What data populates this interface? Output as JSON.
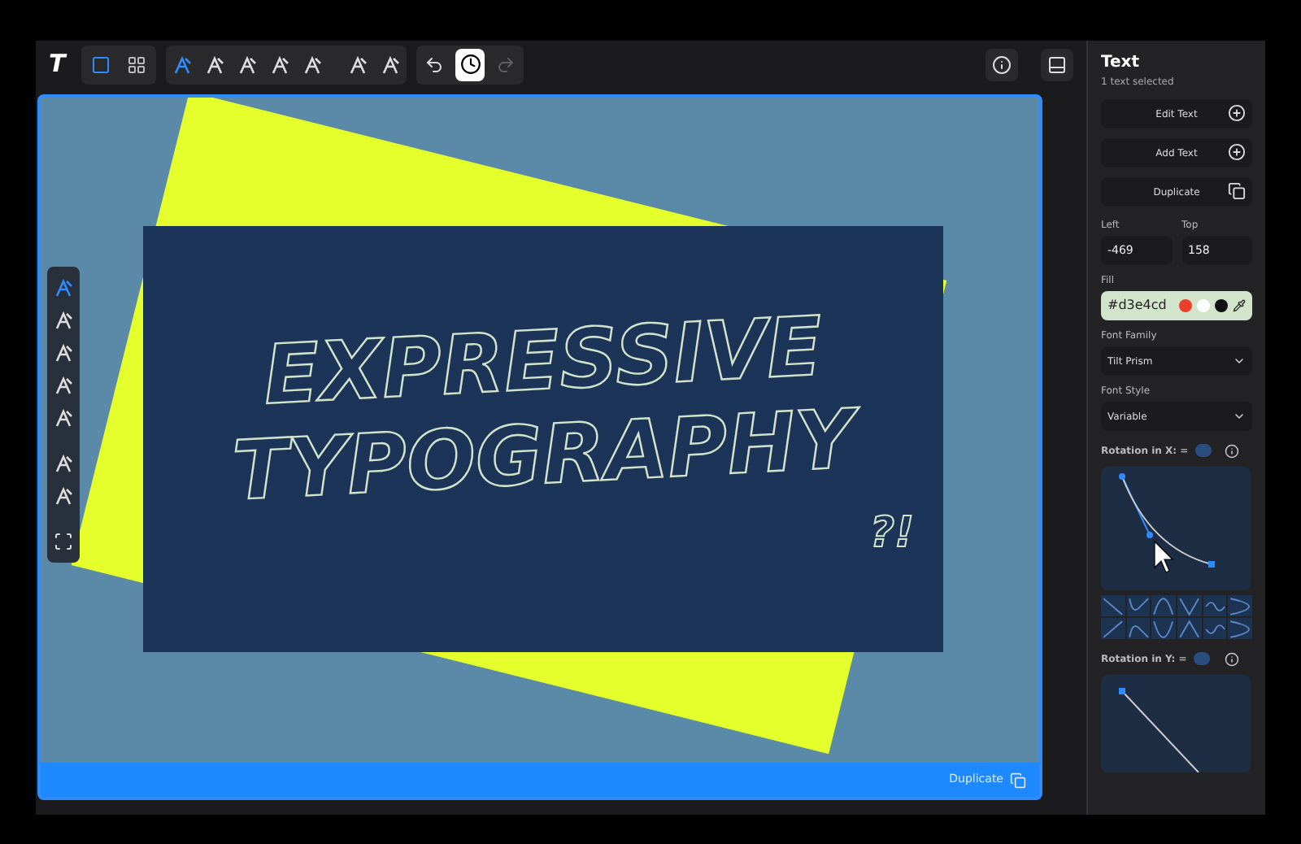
{
  "toolbar": {
    "logo": "T",
    "modes": [
      {
        "kind": "square",
        "selected": true
      },
      {
        "kind": "grid",
        "selected": false
      }
    ],
    "tilt_tools": [
      {
        "selected": true
      },
      {
        "selected": false
      },
      {
        "selected": false
      },
      {
        "selected": false
      },
      {
        "selected": false
      },
      {
        "selected": false
      },
      {
        "selected": false
      }
    ],
    "history": [
      {
        "kind": "undo",
        "selected": false,
        "disabled": false
      },
      {
        "kind": "clock",
        "selected": true,
        "disabled": false
      },
      {
        "kind": "redo",
        "selected": false,
        "disabled": true
      }
    ]
  },
  "canvas": {
    "lines": [
      "EXPRESSIVE",
      "TYPOGRAPHY"
    ],
    "mark": "?!",
    "palette": [
      {
        "kind": "tilt",
        "selected": true
      },
      {
        "kind": "tilt",
        "selected": false
      },
      {
        "kind": "tilt",
        "selected": false
      },
      {
        "kind": "tilt",
        "selected": false
      },
      {
        "kind": "tilt",
        "selected": false
      },
      {
        "kind": "tilt",
        "selected": false
      },
      {
        "kind": "tilt",
        "selected": false
      },
      {
        "kind": "frame",
        "selected": false
      }
    ],
    "footer_action": "Duplicate"
  },
  "panel": {
    "title": "Text",
    "subtitle": "1 text selected",
    "actions": [
      {
        "label": "Edit Text",
        "kind": "plus"
      },
      {
        "label": "Add Text",
        "kind": "plus"
      },
      {
        "label": "Duplicate",
        "kind": "copy"
      }
    ],
    "position": [
      {
        "label": "Left",
        "value": "-469"
      },
      {
        "label": "Top",
        "value": "158"
      }
    ],
    "fill": {
      "label": "Fill",
      "value": "#d3e4cd",
      "swatches": [
        {
          "color": "#e8402a"
        },
        {
          "color": "#ffffff"
        },
        {
          "color": "#111111"
        }
      ]
    },
    "font_family": {
      "label": "Font Family",
      "value": "Tilt Prism"
    },
    "font_style": {
      "label": "Font Style",
      "value": "Variable"
    },
    "rotation_x": {
      "label": "Rotation in X: ="
    },
    "rotation_y": {
      "label": "Rotation in Y: ="
    }
  }
}
